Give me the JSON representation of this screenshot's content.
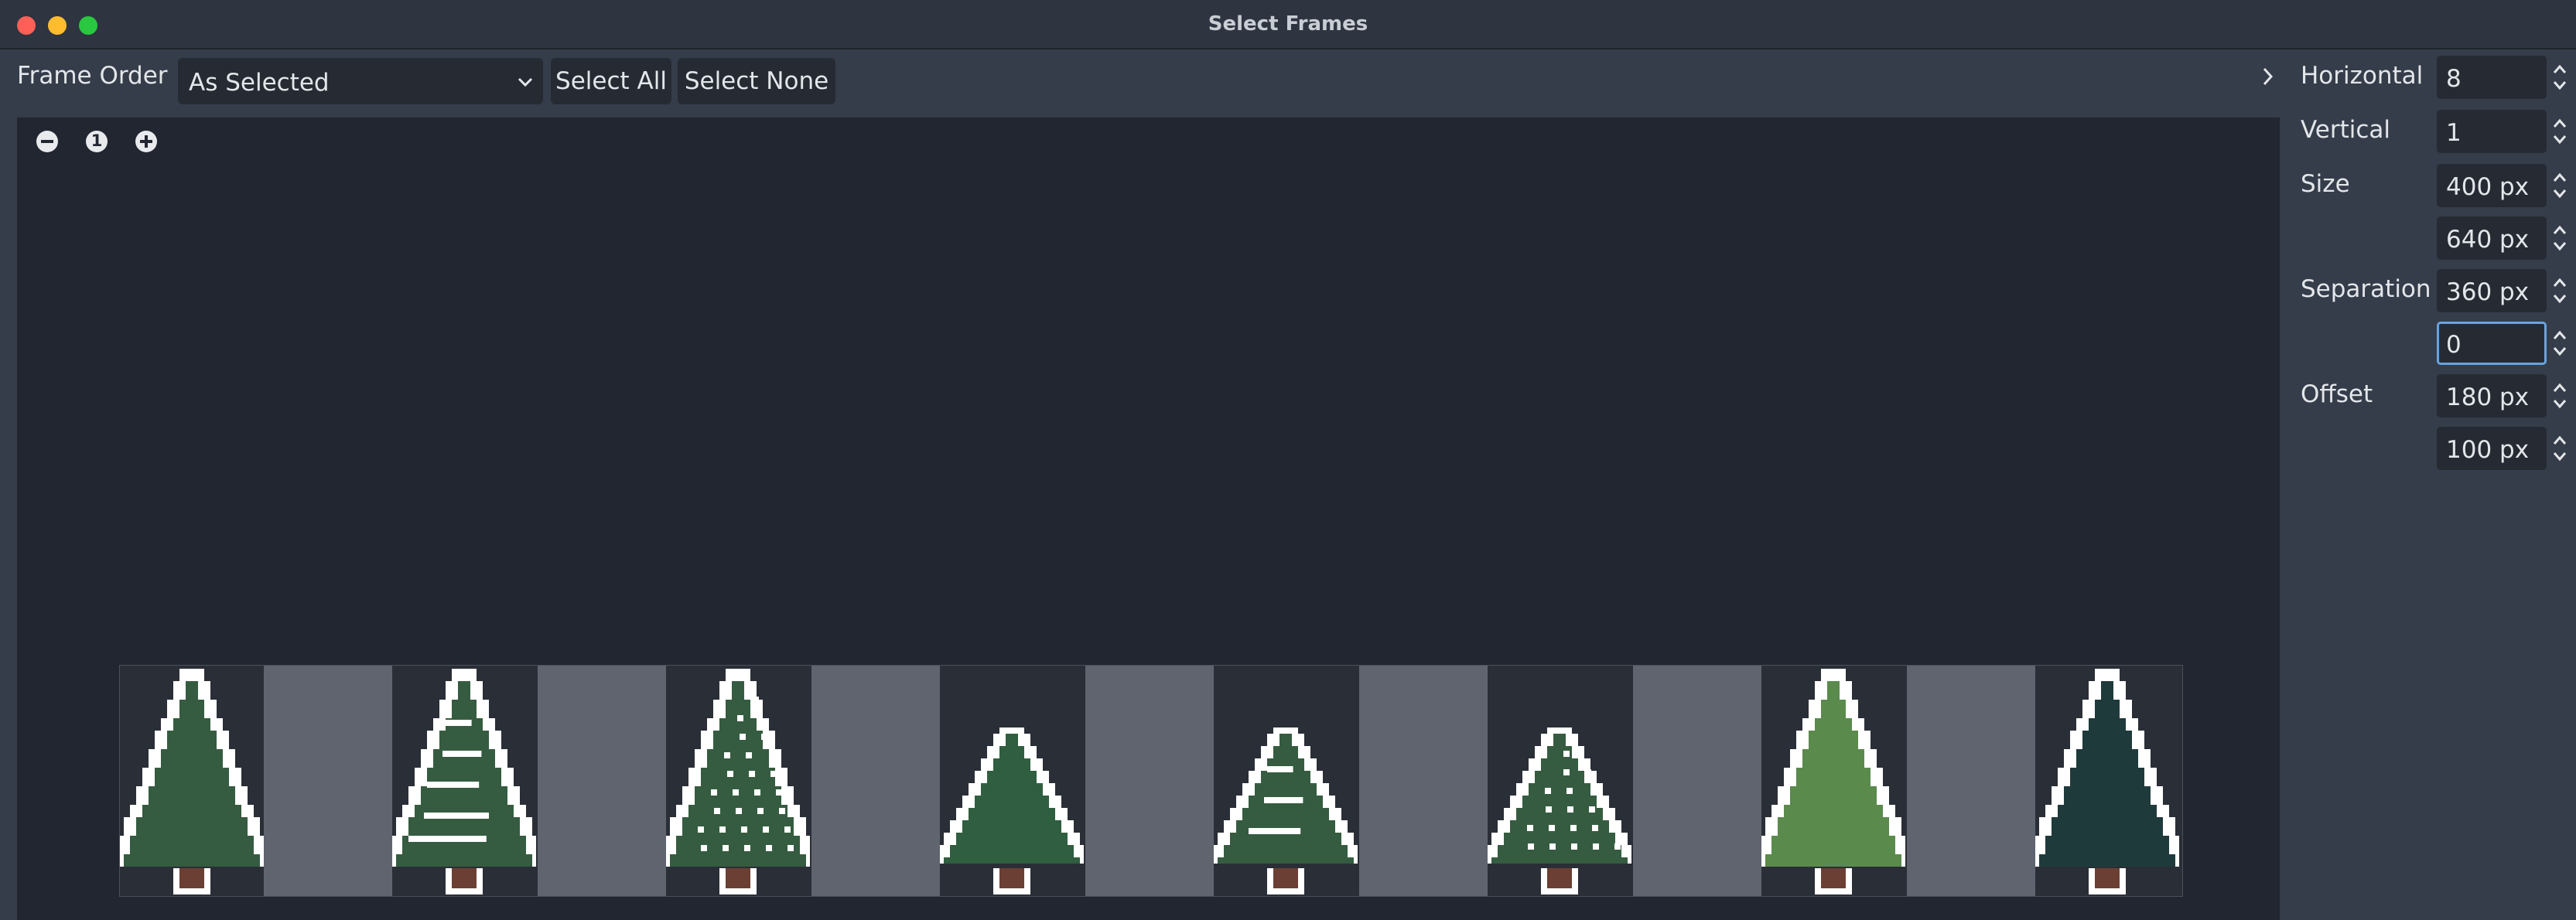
{
  "window": {
    "title": "Select Frames",
    "controls": [
      "close",
      "minimize",
      "zoom"
    ]
  },
  "toolbar": {
    "frame_order_label": "Frame Order",
    "frame_order_value": "As Selected",
    "select_all": "Select All",
    "select_none": "Select None"
  },
  "viewport": {
    "zoom_out_icon": "minus-circle-icon",
    "zoom_reset_label": "1",
    "zoom_in_icon": "plus-circle-icon"
  },
  "panel": {
    "horizontal_label": "Horizontal",
    "horizontal_value": "8",
    "vertical_label": "Vertical",
    "vertical_value": "1",
    "size_label": "Size",
    "size_x": "400 px",
    "size_y": "640 px",
    "separation_label": "Separation",
    "separation_x": "360 px",
    "separation_y": "0",
    "offset_label": "Offset",
    "offset_x": "180 px",
    "offset_y": "100 px"
  },
  "frames": [
    {
      "style": "plain",
      "color": "#355c40"
    },
    {
      "style": "snow-bands",
      "color": "#355c40"
    },
    {
      "style": "snow-dots",
      "color": "#355c40"
    },
    {
      "style": "plain-small",
      "color": "#2f5e40"
    },
    {
      "style": "snow-bands-small",
      "color": "#355c40"
    },
    {
      "style": "snow-dots-small",
      "color": "#355c40"
    },
    {
      "style": "plain",
      "color": "#5a8a4c"
    },
    {
      "style": "plain",
      "color": "#1f3a3a"
    }
  ],
  "colors": {
    "window_bg": "#363d4a",
    "viewport_bg": "#222630",
    "input_bg": "#262b33",
    "focus": "#6aa3e0",
    "separator_gap": "#60646f",
    "trunk": "#6b3f33",
    "snow": "#ffffff"
  }
}
